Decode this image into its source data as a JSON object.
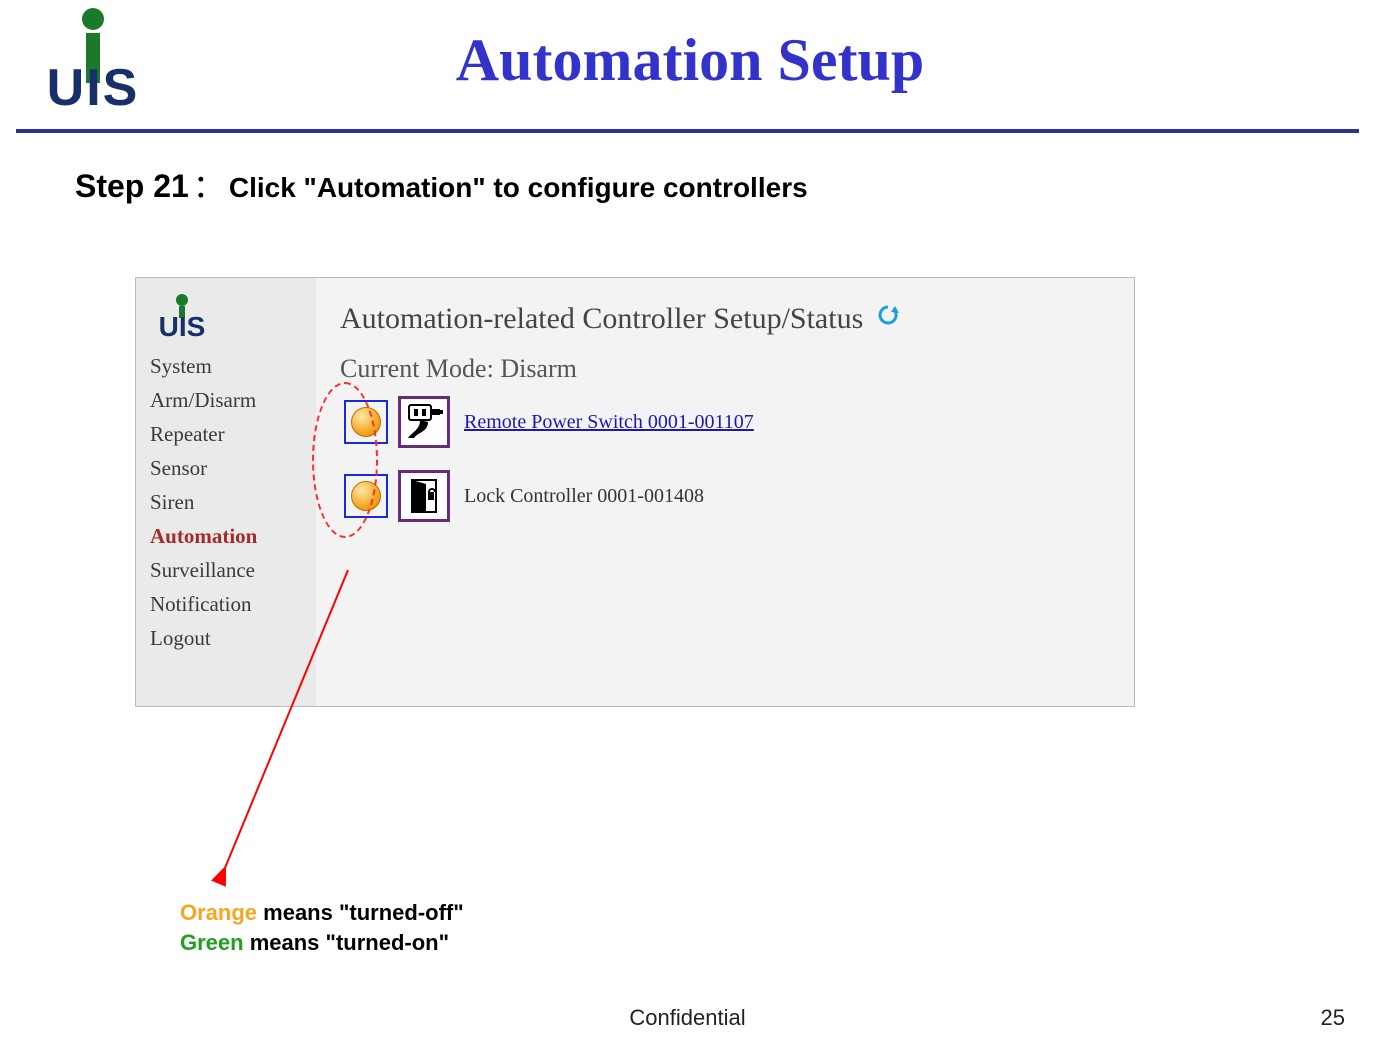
{
  "header": {
    "logo_text": "UIS",
    "title": "Automation Setup"
  },
  "step": {
    "label": "Step 21",
    "colon": "：",
    "desc": "Click \"Automation\" to configure controllers"
  },
  "panel": {
    "sidebar": {
      "logo": "UIS",
      "items": [
        {
          "label": "System",
          "active": false
        },
        {
          "label": "Arm/Disarm",
          "active": false
        },
        {
          "label": "Repeater",
          "active": false
        },
        {
          "label": "Sensor",
          "active": false
        },
        {
          "label": "Siren",
          "active": false
        },
        {
          "label": "Automation",
          "active": true
        },
        {
          "label": "Surveillance",
          "active": false
        },
        {
          "label": "Notification",
          "active": false
        },
        {
          "label": "Logout",
          "active": false
        }
      ]
    },
    "main": {
      "title": "Automation-related Controller Setup/Status",
      "mode_prefix": "Current Mode: ",
      "mode_value": "Disarm",
      "controllers": [
        {
          "status": "off",
          "icon": "plug",
          "label": "Remote Power Switch 0001-001107",
          "link": true
        },
        {
          "status": "off",
          "icon": "lock",
          "label": "Lock Controller 0001-001408",
          "link": false
        }
      ]
    }
  },
  "legend": {
    "orange_word": "Orange",
    "orange_rest": " means \"turned-off\"",
    "green_word": "Green",
    "green_rest": " means \"turned-on\""
  },
  "footer": {
    "confidential": "Confidential",
    "page": "25"
  }
}
